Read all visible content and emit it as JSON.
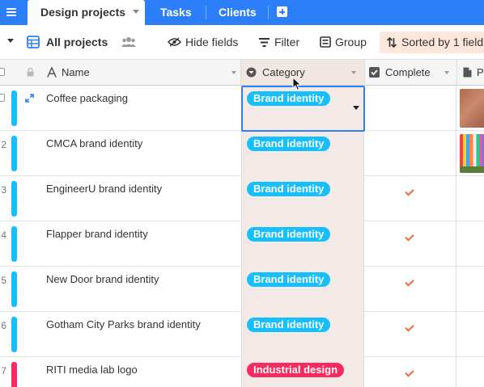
{
  "tabs": {
    "active": "Design projects",
    "others": [
      "Tasks",
      "Clients"
    ]
  },
  "toolbar": {
    "view_name": "All projects",
    "hide_fields": "Hide fields",
    "filter": "Filter",
    "group": "Group",
    "sorted": "Sorted by 1 field"
  },
  "columns": {
    "name": "Name",
    "category": "Category",
    "complete": "Complete",
    "photo": "P"
  },
  "rows": [
    {
      "num": "",
      "name": "Coffee packaging",
      "category": "Brand identity",
      "complete": false,
      "bar_color": "#18bfff",
      "has_photo": true
    },
    {
      "num": "2",
      "name": "CMCA brand identity",
      "category": "Brand identity",
      "complete": false,
      "bar_color": "#18bfff",
      "has_photo": true
    },
    {
      "num": "3",
      "name": "EngineerU brand identity",
      "category": "Brand identity",
      "complete": true,
      "bar_color": "#18bfff",
      "has_photo": false
    },
    {
      "num": "4",
      "name": "Flapper brand identity",
      "category": "Brand identity",
      "complete": true,
      "bar_color": "#18bfff",
      "has_photo": false
    },
    {
      "num": "5",
      "name": "New Door brand identity",
      "category": "Brand identity",
      "complete": true,
      "bar_color": "#18bfff",
      "has_photo": false
    },
    {
      "num": "6",
      "name": "Gotham City Parks brand identity",
      "category": "Brand identity",
      "complete": true,
      "bar_color": "#18bfff",
      "has_photo": false
    },
    {
      "num": "7",
      "name": "RITI media lab logo",
      "category": "Industrial design",
      "complete": true,
      "bar_color": "#f82b60",
      "has_photo": false
    }
  ],
  "colors": {
    "accent": "#2d7ff9",
    "brand_identity": "#18bfff",
    "industrial_design": "#f82b60",
    "check": "#f06a3a"
  }
}
